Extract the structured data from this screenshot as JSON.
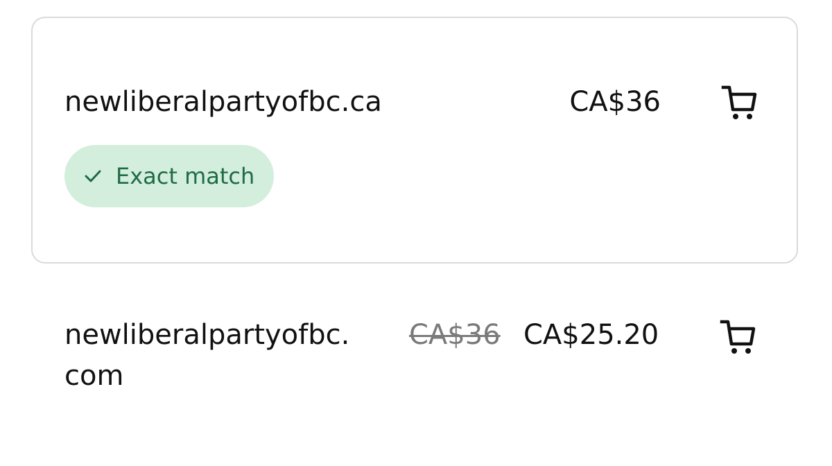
{
  "results": [
    {
      "domain": "newliberalpartyofbc.ca",
      "price": "CA$36",
      "badge": {
        "icon": "check-icon",
        "label": "Exact match"
      },
      "cart_icon": "cart-icon"
    },
    {
      "domain_line1": "newliberalpartyofbc.",
      "domain_line2": "com",
      "original_price": "CA$36",
      "price": "CA$25.20",
      "cart_icon": "cart-icon"
    }
  ],
  "colors": {
    "badge_bg": "#d3eedd",
    "badge_text": "#1f6b45",
    "card_border": "#dadada",
    "strikethrough_text": "#7a7a7a"
  }
}
